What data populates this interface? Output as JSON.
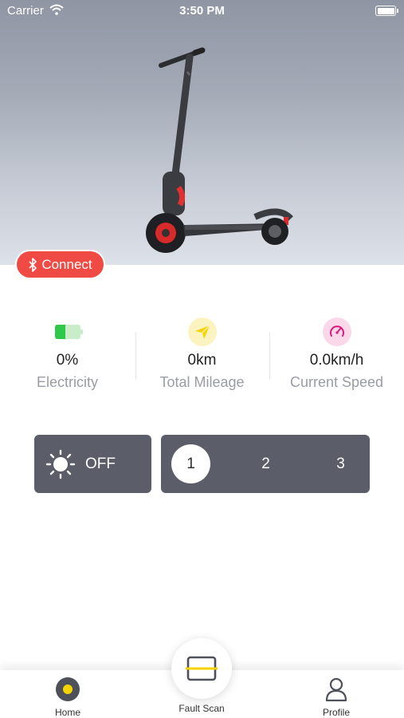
{
  "status_bar": {
    "carrier": "Carrier",
    "time": "3:50 PM"
  },
  "hero": {
    "image": "electric-scooter-photo"
  },
  "connect": {
    "label": "Connect",
    "color": "#f04a44"
  },
  "stats": [
    {
      "value": "0%",
      "label": "Electricity",
      "icon": "battery-icon"
    },
    {
      "value": "0km",
      "label": "Total Mileage",
      "icon": "paper-plane-icon"
    },
    {
      "value": "0.0km/h",
      "label": "Current Speed",
      "icon": "speedometer-icon"
    }
  ],
  "light": {
    "label": "OFF",
    "icon": "sun-icon"
  },
  "gears": {
    "options": [
      "1",
      "2",
      "3"
    ],
    "selected": "1"
  },
  "tabs": [
    {
      "label": "Home",
      "icon": "home-icon"
    },
    {
      "label": "Fault Scan",
      "icon": "scan-icon"
    },
    {
      "label": "Profile",
      "icon": "profile-icon"
    }
  ],
  "colors": {
    "accent_yellow": "#f5d400",
    "panel": "#5b5e69",
    "battery_green": "#2ec94a",
    "speed_pink": "#e0197d"
  }
}
